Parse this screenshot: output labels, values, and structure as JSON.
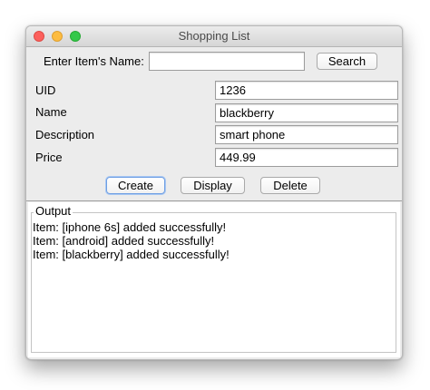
{
  "window": {
    "title": "Shopping List"
  },
  "search": {
    "label": "Enter Item's Name:",
    "value": "",
    "button_label": "Search"
  },
  "form": {
    "fields": [
      {
        "label": "UID",
        "value": "1236"
      },
      {
        "label": "Name",
        "value": "blackberry"
      },
      {
        "label": "Description",
        "value": "smart phone"
      },
      {
        "label": "Price",
        "value": "449.99"
      }
    ]
  },
  "actions": {
    "create_label": "Create",
    "display_label": "Display",
    "delete_label": "Delete"
  },
  "output": {
    "legend": "Output",
    "lines": [
      "Item: [iphone 6s] added successfully!",
      "Item: [android] added successfully!",
      "Item: [blackberry] added successfully!"
    ]
  },
  "colors": {
    "close": "#fc605c",
    "minimize": "#fdbc40",
    "maximize": "#34c84a",
    "focus_ring": "#6f9fe3"
  }
}
